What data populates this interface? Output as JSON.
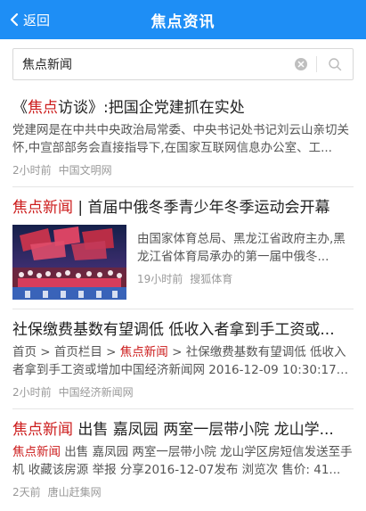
{
  "header": {
    "back_label": "返回",
    "title": "焦点资讯"
  },
  "search": {
    "value": "焦点新闻"
  },
  "results": [
    {
      "title_pre": "《",
      "title_hl": "焦点",
      "title_post": "访谈》:把国企党建抓在实处",
      "snippet": "党建网是在中共中央政治局常委、中央书记处书记刘云山亲切关怀,中宣部部务会直接指导下,在国家互联网信息办公室、工...",
      "time": "2小时前",
      "source": "中国文明网"
    },
    {
      "title_hl": "焦点新闻",
      "title_post": " | 首届中俄冬季青少年冬季运动会开幕",
      "snippet": "由国家体育总局、黑龙江省政府主办,黑龙江省体育局承办的第一届中俄冬...",
      "time": "19小时前",
      "source": "搜狐体育"
    },
    {
      "title": "社保缴费基数有望调低 低收入者拿到手工资或...",
      "snippet_pre": "首页 > 首页栏目 > ",
      "snippet_hl": "焦点新闻",
      "snippet_post": " > 社保缴费基数有望调低 低收入者拿到手工资或增加中国经济新闻网 2016-12-09 10:30:17原标...",
      "time": "2小时前",
      "source": "中国经济新闻网"
    },
    {
      "title_hl": "焦点新闻",
      "title_post": " 出售 嘉凤园 两室一层带小院 龙山学...",
      "snippet_hl": "焦点新闻",
      "snippet_post": " 出售 嘉凤园 两室一层带小院 龙山学区房短信发送至手机 收藏该房源 举报 分享2016-12-07发布 浏览次 售价: 41...",
      "time": "2天前",
      "source": "唐山赶集网"
    }
  ]
}
